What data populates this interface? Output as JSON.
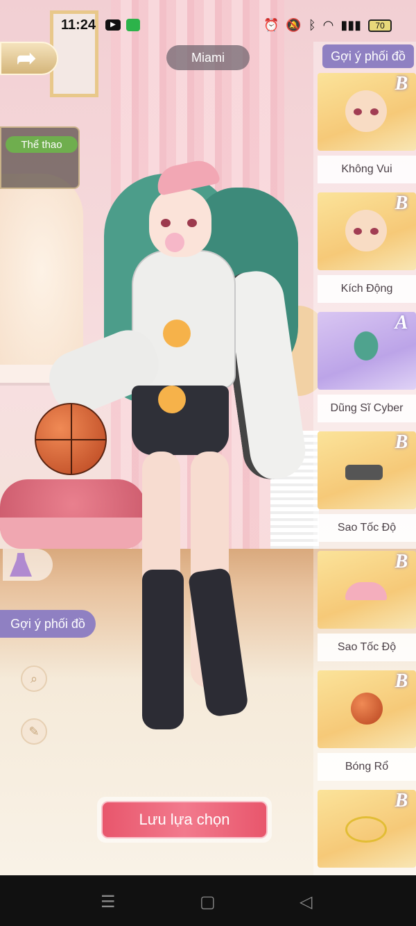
{
  "status_bar": {
    "time": "11:24",
    "battery": "70"
  },
  "header": {
    "location": "Miami"
  },
  "theme": {
    "tag": "Thể thao"
  },
  "left_rail": {
    "suggest_label": "Gợi ý phối đồ",
    "search_icon": "search-icon",
    "broom_icon": "broom-icon"
  },
  "right_rail": {
    "title": "Gợi ý phối đồ",
    "items": [
      {
        "grade": "B",
        "label": "Không Vui",
        "icon": "face-expression-icon"
      },
      {
        "grade": "B",
        "label": "Kích Động",
        "icon": "face-expression-icon"
      },
      {
        "grade": "A",
        "label": "Dũng Sĩ Cyber",
        "icon": "hair-icon"
      },
      {
        "grade": "B",
        "label": "Sao Tốc Độ",
        "icon": "device-icon"
      },
      {
        "grade": "B",
        "label": "Sao Tốc Độ",
        "icon": "cap-icon"
      },
      {
        "grade": "B",
        "label": "Bóng Rổ",
        "icon": "basketball-icon"
      },
      {
        "grade": "B",
        "label": "",
        "icon": "necklace-icon"
      }
    ]
  },
  "actions": {
    "save_label": "Lưu lựa chọn"
  },
  "colors": {
    "accent_purple": "#8f80c2",
    "save_pink": "#e8566c",
    "theme_green": "#6fae4e"
  }
}
